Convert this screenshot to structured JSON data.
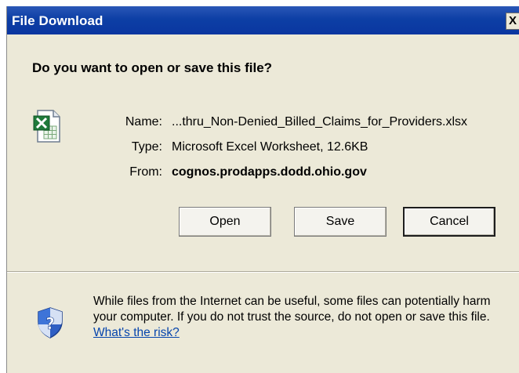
{
  "window": {
    "title": "File Download",
    "close_glyph": "X"
  },
  "dialog": {
    "question": "Do you want to open or save this file?",
    "file_icon": "excel-file-icon",
    "fields": {
      "name_label": "Name:",
      "name_value": "...thru_Non-Denied_Billed_Claims_for_Providers.xlsx",
      "type_label": "Type:",
      "type_value": "Microsoft Excel Worksheet, 12.6KB",
      "from_label": "From:",
      "from_value": "cognos.prodapps.dodd.ohio.gov"
    },
    "buttons": {
      "open": "Open",
      "save": "Save",
      "cancel": "Cancel"
    },
    "warning": {
      "icon": "security-shield-icon",
      "text": "While files from the Internet can be useful, some files can potentially harm your computer. If you do not trust the source, do not open or save this file. ",
      "link": "What's the risk?"
    }
  },
  "colors": {
    "titlebar": "#0a36a0",
    "dialog_bg": "#ece9d8",
    "link": "#0645ad"
  }
}
